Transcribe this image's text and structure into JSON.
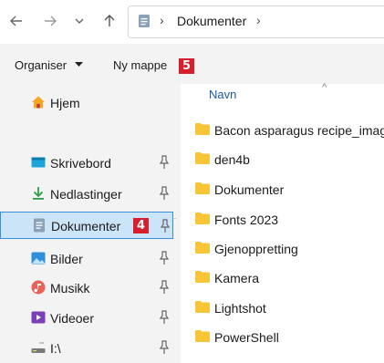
{
  "address": {
    "crumb": "Dokumenter"
  },
  "commands": {
    "organize": "Organiser",
    "new_folder": "Ny mappe"
  },
  "badges": {
    "new_folder_step": "5",
    "documents_step": "4"
  },
  "sidebar": {
    "home": "Hjem",
    "items": [
      {
        "label": "Skrivebord",
        "icon": "desktop-icon"
      },
      {
        "label": "Nedlastinger",
        "icon": "download-icon"
      },
      {
        "label": "Dokumenter",
        "icon": "document-icon"
      },
      {
        "label": "Bilder",
        "icon": "pictures-icon"
      },
      {
        "label": "Musikk",
        "icon": "music-icon"
      },
      {
        "label": "Videoer",
        "icon": "video-icon"
      },
      {
        "label": "I:\\",
        "icon": "drive-icon"
      }
    ]
  },
  "main": {
    "column_name": "Navn",
    "files": [
      "Bacon asparagus recipe_imag",
      "den4b",
      "Dokumenter",
      "Fonts 2023",
      "Gjenoppretting",
      "Kamera",
      "Lightshot",
      "PowerShell"
    ]
  },
  "colors": {
    "selection": "#cce4f7",
    "selection_border": "#3b8fd9",
    "badge": "#d81d2c",
    "folder": "#f8c537"
  }
}
